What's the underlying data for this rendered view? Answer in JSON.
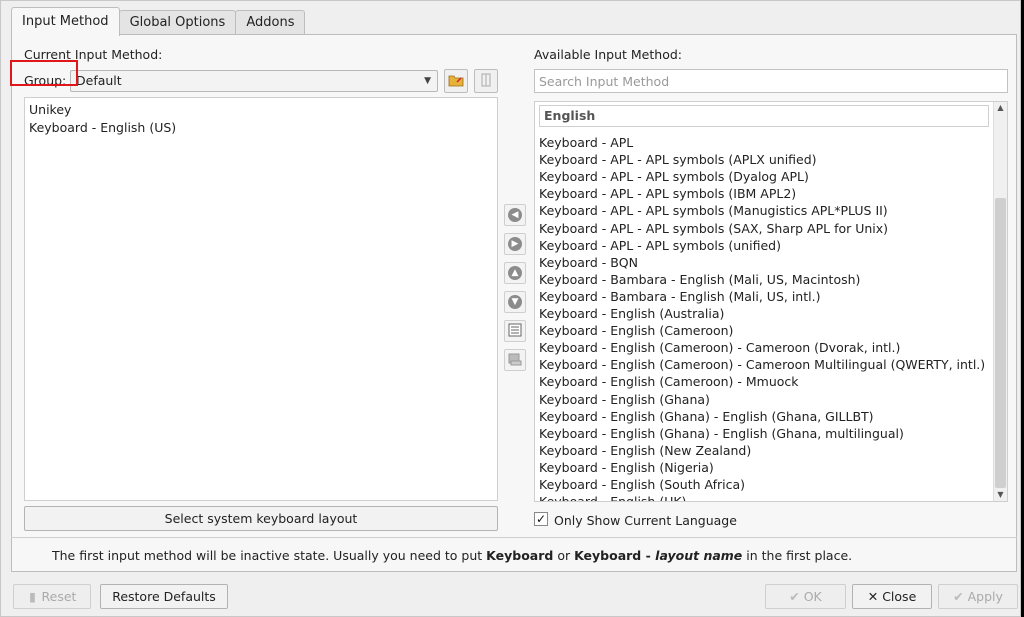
{
  "tabs": [
    {
      "label": "Input Method"
    },
    {
      "label": "Global Options"
    },
    {
      "label": "Addons"
    }
  ],
  "current": {
    "title": "Current Input Method:",
    "group_label": "Group:",
    "group_value": "Default",
    "items": [
      "Unikey",
      "Keyboard - English (US)"
    ],
    "select_layout_button": "Select system keyboard layout"
  },
  "available": {
    "title": "Available Input Method:",
    "search_placeholder": "Search Input Method",
    "category": "English",
    "items": [
      "Keyboard - APL",
      "Keyboard - APL - APL symbols (APLX unified)",
      "Keyboard - APL - APL symbols (Dyalog APL)",
      "Keyboard - APL - APL symbols (IBM APL2)",
      "Keyboard - APL - APL symbols (Manugistics APL*PLUS II)",
      "Keyboard - APL - APL symbols (SAX, Sharp APL for Unix)",
      "Keyboard - APL - APL symbols (unified)",
      "Keyboard - BQN",
      "Keyboard - Bambara - English (Mali, US, Macintosh)",
      "Keyboard - Bambara - English (Mali, US, intl.)",
      "Keyboard - English (Australia)",
      "Keyboard - English (Cameroon)",
      "Keyboard - English (Cameroon) - Cameroon (Dvorak, intl.)",
      "Keyboard - English (Cameroon) - Cameroon Multilingual (QWERTY, intl.)",
      "Keyboard - English (Cameroon) - Mmuock",
      "Keyboard - English (Ghana)",
      "Keyboard - English (Ghana) - English (Ghana, GILLBT)",
      "Keyboard - English (Ghana) - English (Ghana, multilingual)",
      "Keyboard - English (New Zealand)",
      "Keyboard - English (Nigeria)",
      "Keyboard - English (South Africa)",
      "Keyboard - English (UK)"
    ],
    "only_current_language": "Only Show Current Language",
    "only_current_language_checked": true
  },
  "hint": {
    "prefix": "The first input method will be inactive state. Usually you need to put ",
    "b1": "Keyboard",
    "mid": " or ",
    "b2": "Keyboard - ",
    "b2i": "layout name",
    "suffix": " in the first place."
  },
  "footer": {
    "reset": "Reset",
    "restore_defaults": "Restore Defaults",
    "ok": "OK",
    "close": "Close",
    "apply": "Apply"
  },
  "colors": {
    "highlight_box": "#e0161b"
  },
  "icons": [
    "folder-settings-icon",
    "keyboard-config-icon",
    "arrow-left-icon",
    "arrow-right-icon",
    "arrow-up-icon",
    "arrow-down-icon",
    "configure-icon",
    "keyboard-layout-icon",
    "broom-icon",
    "ok-check-icon",
    "close-x-icon",
    "apply-check-icon"
  ]
}
